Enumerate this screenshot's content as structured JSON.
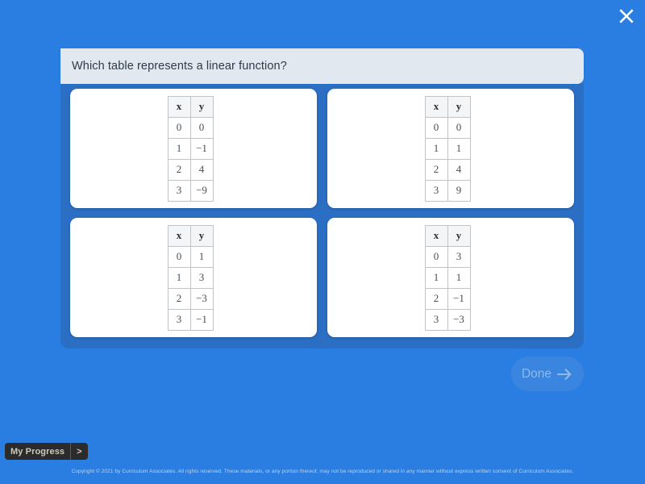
{
  "header": {
    "question": "Which table represents a linear function?"
  },
  "close": {
    "icon": "close-icon"
  },
  "choices": [
    {
      "id": "choice-a",
      "columns": [
        "x",
        "y"
      ],
      "rows": [
        [
          "0",
          "0"
        ],
        [
          "1",
          "−1"
        ],
        [
          "2",
          "4"
        ],
        [
          "3",
          "−9"
        ]
      ]
    },
    {
      "id": "choice-b",
      "columns": [
        "x",
        "y"
      ],
      "rows": [
        [
          "0",
          "0"
        ],
        [
          "1",
          "1"
        ],
        [
          "2",
          "4"
        ],
        [
          "3",
          "9"
        ]
      ]
    },
    {
      "id": "choice-c",
      "columns": [
        "x",
        "y"
      ],
      "rows": [
        [
          "0",
          "1"
        ],
        [
          "1",
          "3"
        ],
        [
          "2",
          "−3"
        ],
        [
          "3",
          "−1"
        ]
      ]
    },
    {
      "id": "choice-d",
      "columns": [
        "x",
        "y"
      ],
      "rows": [
        [
          "0",
          "3"
        ],
        [
          "1",
          "1"
        ],
        [
          "2",
          "−1"
        ],
        [
          "3",
          "−3"
        ]
      ]
    }
  ],
  "done": {
    "label": "Done",
    "icon": "arrow-right-icon",
    "enabled": false
  },
  "progress": {
    "label": "My Progress",
    "chevron": ">"
  },
  "footer": {
    "copyright": "Copyright © 2021 by Curriculum Associates. All rights reserved. These materials, or any portion thereof, may not be reproduced or shared in any manner without express written consent of Curriculum Associates."
  },
  "colors": {
    "background": "#2a7de1",
    "panel": "#2b6fc4",
    "header_bar": "#e2e8f0",
    "card": "#ffffff",
    "done_disabled": "#3a85e0"
  }
}
